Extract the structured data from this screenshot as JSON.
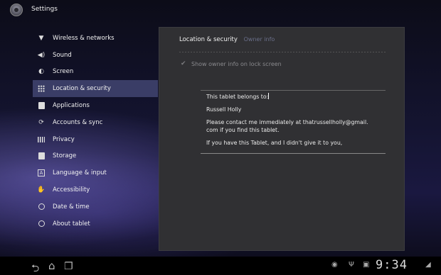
{
  "app": {
    "title": "Settings",
    "icon": "settings-gear-icon"
  },
  "menu": {
    "items": [
      {
        "label": "Wireless & networks",
        "icon": "wireless-icon"
      },
      {
        "label": "Sound",
        "icon": "speaker-icon"
      },
      {
        "label": "Screen",
        "icon": "screen-icon"
      },
      {
        "label": "Location & security",
        "icon": "location-grid-icon",
        "selected": true
      },
      {
        "label": "Applications",
        "icon": "applications-icon"
      },
      {
        "label": "Accounts & sync",
        "icon": "sync-icon"
      },
      {
        "label": "Privacy",
        "icon": "privacy-icon"
      },
      {
        "label": "Storage",
        "icon": "storage-icon"
      },
      {
        "label": "Language & input",
        "icon": "language-icon"
      },
      {
        "label": "Accessibility",
        "icon": "hand-icon"
      },
      {
        "label": "Date & time",
        "icon": "clock-icon"
      },
      {
        "label": "About tablet",
        "icon": "info-icon"
      }
    ]
  },
  "panel": {
    "title": "Location & security",
    "subtitle": "Owner info",
    "checkbox_label": "Show owner info on lock screen",
    "owner_text": {
      "line1": "This tablet belongs to:",
      "line2": "Russell Holly",
      "line3a": "Please contact me immediately at thatrussellholly@gmail.",
      "line3b": "com if you find this tablet.",
      "line4": "If you have this Tablet, and I didn't give it to you,"
    }
  },
  "system_bar": {
    "clock": "9:34",
    "nav": [
      "back-icon",
      "home-icon",
      "recent-apps-icon"
    ]
  },
  "colors": {
    "selected_item": "#3a3d66",
    "panel_bg": "#303033",
    "subtitle": "#6a6f8a"
  }
}
